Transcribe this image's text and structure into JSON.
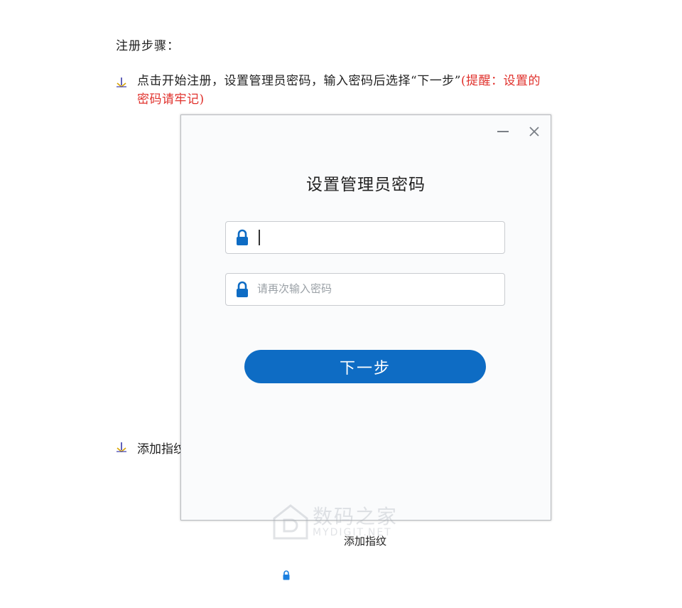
{
  "document": {
    "heading": "注册步骤：",
    "step1_text": "点击开始注册，设置管理员密码，输入密码后选择“下一步”",
    "step1_note_line1": "(提醒：设置的",
    "step1_note_line2": "密码请牢记)",
    "step2_text": "添加指纹",
    "caption": "添加指纹"
  },
  "dialog": {
    "title": "设置管理员密码",
    "password_value": "",
    "confirm_placeholder": "请再次输入密码",
    "next_label": "下一步",
    "minimize_icon": "minimize-icon",
    "close_icon": "close-icon",
    "lock_icon": "lock-icon"
  },
  "watermark": {
    "name_cn": "数码之家",
    "name_en": "MYDIGIT.NET"
  },
  "colors": {
    "accent": "#0e6cc4",
    "note_red": "#e0312c"
  }
}
